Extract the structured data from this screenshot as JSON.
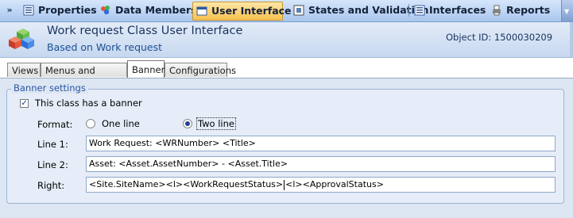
{
  "toolbar": {
    "tabs": [
      {
        "label": "Properties",
        "icon": "properties-icon"
      },
      {
        "label": "Data Members",
        "icon": "data-members-icon"
      },
      {
        "label": "User Interface",
        "icon": "user-interface-icon"
      },
      {
        "label": "States and Validation",
        "icon": "states-validation-icon"
      },
      {
        "label": "Interfaces",
        "icon": "interfaces-icon"
      },
      {
        "label": "Reports",
        "icon": "reports-icon"
      }
    ],
    "active_tab": "User Interface"
  },
  "header": {
    "title": "Work request Class User Interface",
    "subtitle": "Based on Work request",
    "object_id": "Object ID: 1500030209"
  },
  "tabs": [
    {
      "label": "Views"
    },
    {
      "label": "Menus and Toolbars"
    },
    {
      "label": "Banner"
    },
    {
      "label": "Configurations"
    }
  ],
  "active_tab": "Banner",
  "banner_settings": {
    "legend": "Banner settings",
    "has_banner_label": "This class has a banner",
    "has_banner_checked": true,
    "format_label": "Format:",
    "format_options": [
      "One line",
      "Two line"
    ],
    "format_selected": "Two line",
    "line1_label": "Line 1:",
    "line1_value": "Work Request: <WRNumber> <Title>",
    "line2_label": "Line 2:",
    "line2_value": "Asset: <Asset.AssetNumber> - <Asset.Title>",
    "right_label": "Right:",
    "right_value_before_caret": "<Site.SiteName><l><WorkRequestStatus>",
    "right_value_after_caret": "<l><ApprovalStatus>"
  },
  "colors": {
    "toolbar_gradient": [
      "#d6e6fb",
      "#a9c6ee"
    ],
    "active_tab": "#f8c24f",
    "header_title": "#1c3560",
    "legend": "#2a56a3"
  }
}
